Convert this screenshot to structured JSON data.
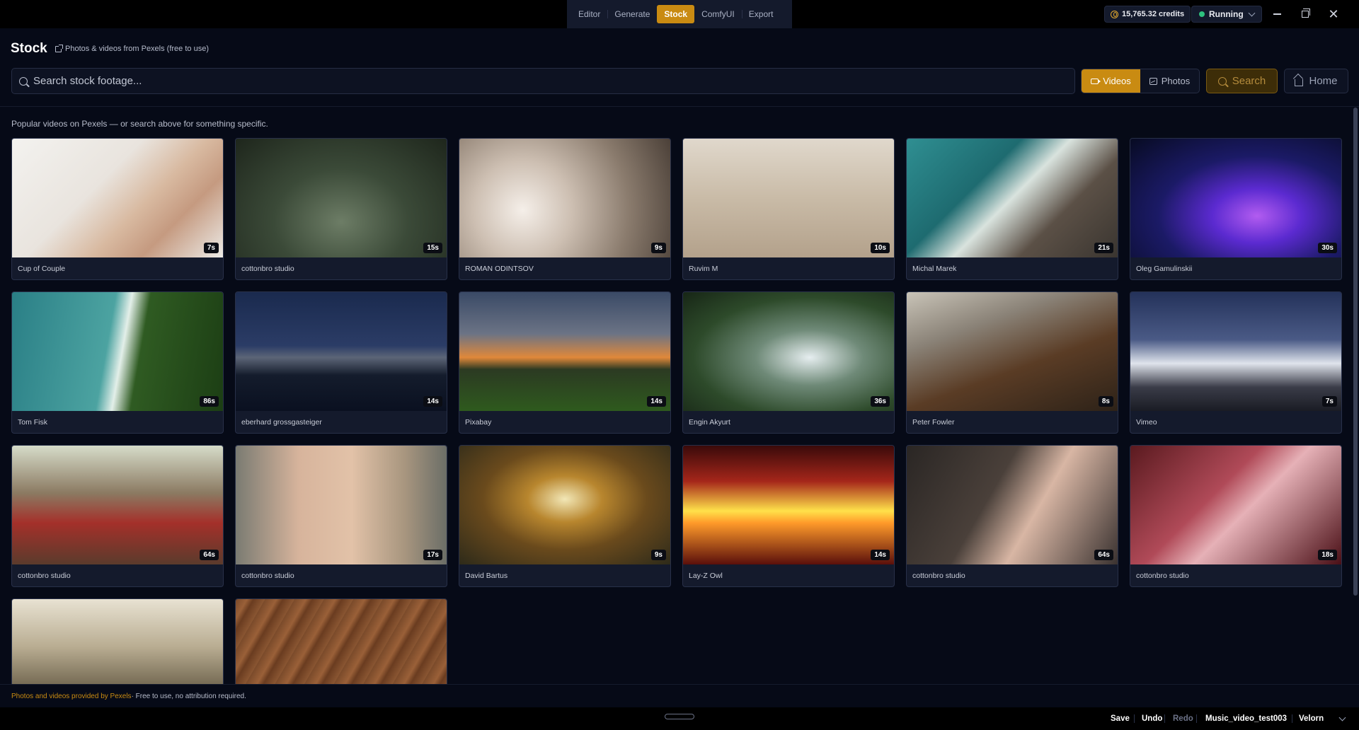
{
  "nav": {
    "tabs": [
      {
        "label": "Editor",
        "active": false
      },
      {
        "label": "Generate",
        "active": false
      },
      {
        "label": "Stock",
        "active": true
      },
      {
        "label": "ComfyUI",
        "active": false
      },
      {
        "label": "Export",
        "active": false
      }
    ],
    "credits": "15,765.32 credits",
    "status": "Running",
    "status_color": "#2ec27e",
    "accent": "#c98b12"
  },
  "header": {
    "title": "Stock",
    "subtitle": "Photos & videos from Pexels (free to use)"
  },
  "search": {
    "placeholder": "Search stock footage...",
    "value": "",
    "videos_label": "Videos",
    "photos_label": "Photos",
    "search_label": "Search",
    "home_label": "Home",
    "active_media": "Videos"
  },
  "hint": "Popular videos on Pexels — or search above for something specific.",
  "cards": [
    {
      "author": "Cup of Couple",
      "duration": "7s",
      "thumb": "hands-seedling"
    },
    {
      "author": "cottonbro studio",
      "duration": "15s",
      "thumb": "forest-stream"
    },
    {
      "author": "ROMAN ODINTSOV",
      "duration": "9s",
      "thumb": "cherry-blossom"
    },
    {
      "author": "Ruvim M",
      "duration": "10s",
      "thumb": "seal-on-sand"
    },
    {
      "author": "Michal Marek",
      "duration": "21s",
      "thumb": "aerial-coast"
    },
    {
      "author": "Oleg Gamulinskii",
      "duration": "30s",
      "thumb": "purple-particles"
    },
    {
      "author": "Tom Fisk",
      "duration": "86s",
      "thumb": "aerial-shore"
    },
    {
      "author": "eberhard grossgasteiger",
      "duration": "14s",
      "thumb": "mountain-lake-night"
    },
    {
      "author": "Pixabay",
      "duration": "14s",
      "thumb": "sunset-tree"
    },
    {
      "author": "Engin Akyurt",
      "duration": "36s",
      "thumb": "waterfall"
    },
    {
      "author": "Peter Fowler",
      "duration": "8s",
      "thumb": "rocky-waves"
    },
    {
      "author": "Vimeo",
      "duration": "7s",
      "thumb": "snowy-mountain-stars"
    },
    {
      "author": "cottonbro studio",
      "duration": "64s",
      "thumb": "couple-red-van"
    },
    {
      "author": "cottonbro studio",
      "duration": "17s",
      "thumb": "knees-closeup"
    },
    {
      "author": "David Bartus",
      "duration": "9s",
      "thumb": "autumn-road"
    },
    {
      "author": "Lay-Z Owl",
      "duration": "14s",
      "thumb": "abstract-red-yellow"
    },
    {
      "author": "cottonbro studio",
      "duration": "64s",
      "thumb": "hand-stockings"
    },
    {
      "author": "cottonbro studio",
      "duration": "18s",
      "thumb": "red-hands"
    },
    {
      "author": "",
      "duration": "",
      "thumb": "grass-sunset"
    },
    {
      "author": "",
      "duration": "",
      "thumb": "wood-grain"
    }
  ],
  "footer": {
    "credit_link": "Photos and videos provided by Pexels",
    "credit_rest": " · Free to use, no attribution required."
  },
  "bottombar": {
    "save": "Save",
    "undo": "Undo",
    "redo": "Redo",
    "project": "Music_video_test003",
    "workspace": "Velorn"
  }
}
